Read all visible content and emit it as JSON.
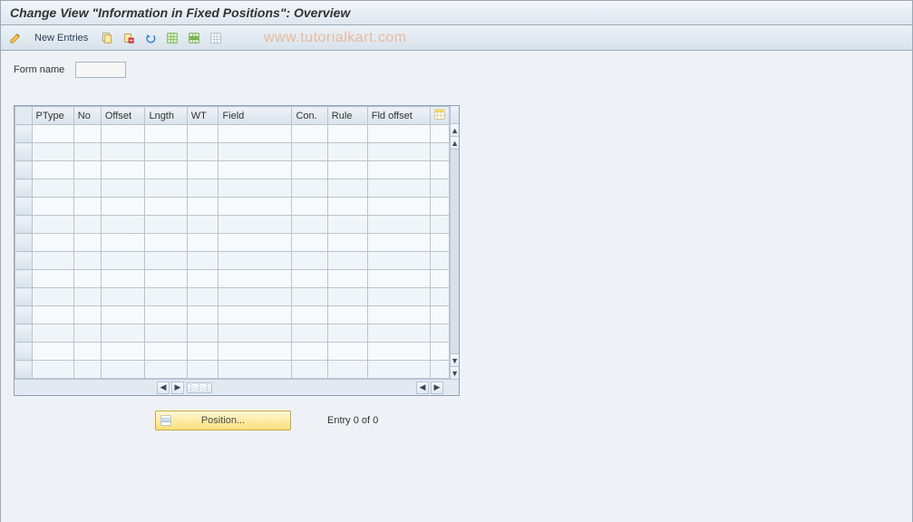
{
  "titlebar": {
    "title": "Change View \"Information in Fixed Positions\": Overview"
  },
  "toolbar": {
    "new_entries_label": "New Entries",
    "watermark": "www.tutorialkart.com"
  },
  "icons": {
    "toggle": "toggle-change-display-icon",
    "copy": "copy-as-icon",
    "delete": "delete-icon",
    "undo": "undo-icon",
    "select_all": "select-all-icon",
    "select_block": "select-block-icon",
    "deselect_all": "deselect-all-icon",
    "table_settings": "table-settings-icon"
  },
  "form": {
    "form_name_label": "Form name",
    "form_name_value": ""
  },
  "table": {
    "columns": [
      "PType",
      "No",
      "Offset",
      "Lngth",
      "WT",
      "Field",
      "Con.",
      "Rule",
      "Fld offset"
    ],
    "visible_row_count": 14
  },
  "footer": {
    "position_button_label": "Position...",
    "entry_text": "Entry 0 of 0"
  }
}
